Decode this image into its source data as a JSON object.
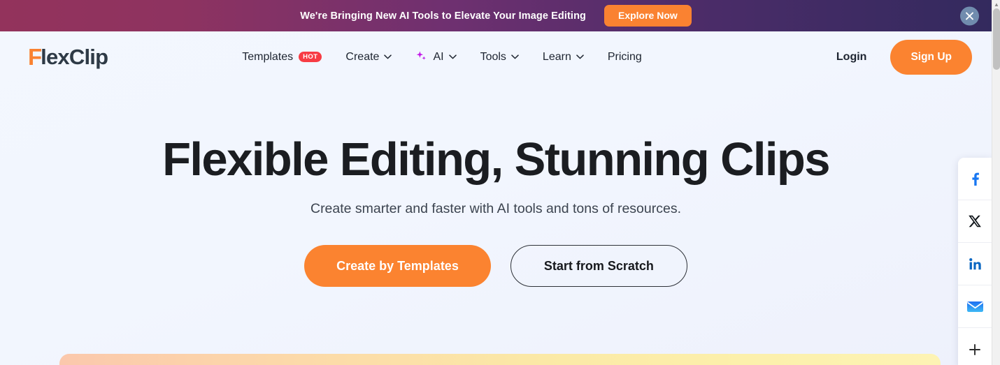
{
  "promo": {
    "text": "We're Bringing New AI Tools to Elevate Your Image Editing",
    "cta_label": "Explore Now",
    "close_icon": "close-icon",
    "gradient_start": "#93335c",
    "gradient_end": "#332a5e",
    "cta_color": "#fa8231"
  },
  "header": {
    "logo": {
      "accent": "F",
      "rest": "lexClip",
      "accent_color": "#fa8231",
      "text_color": "#2e3a46"
    },
    "nav": [
      {
        "label": "Templates",
        "badge": "HOT",
        "caret": "",
        "icon": ""
      },
      {
        "label": "Create",
        "badge": "",
        "caret": "⌄",
        "icon": ""
      },
      {
        "label": "AI",
        "badge": "",
        "caret": "⌄",
        "icon": "sparkle-icon"
      },
      {
        "label": "Tools",
        "badge": "",
        "caret": "⌄",
        "icon": ""
      },
      {
        "label": "Learn",
        "badge": "",
        "caret": "⌄",
        "icon": ""
      },
      {
        "label": "Pricing",
        "badge": "",
        "caret": "",
        "icon": ""
      }
    ],
    "login_label": "Login",
    "signup_label": "Sign Up",
    "signup_color": "#fb8330",
    "badge_color": "#f73c44"
  },
  "hero": {
    "title": "Flexible Editing, Stunning Clips",
    "subtitle": "Create smarter and faster with AI tools and tons of resources.",
    "primary_cta": "Create by Templates",
    "secondary_cta": "Start from Scratch",
    "primary_color": "#fb8330",
    "background": "#f3f7fe"
  },
  "share_rail": [
    {
      "name": "facebook-icon",
      "label": "f",
      "color": "#1877f2"
    },
    {
      "name": "x-twitter-icon",
      "label": "X",
      "color": "#000000"
    },
    {
      "name": "linkedin-icon",
      "label": "in",
      "color": "#0a66c2"
    },
    {
      "name": "email-icon",
      "label": "envelope",
      "color": "#2f80ed"
    },
    {
      "name": "more-share-icon",
      "label": "+",
      "color": "#2b2b2b"
    }
  ],
  "scrollbar": {
    "thumb_color": "#c1c1c1",
    "track_color": "#f1f1f1"
  }
}
